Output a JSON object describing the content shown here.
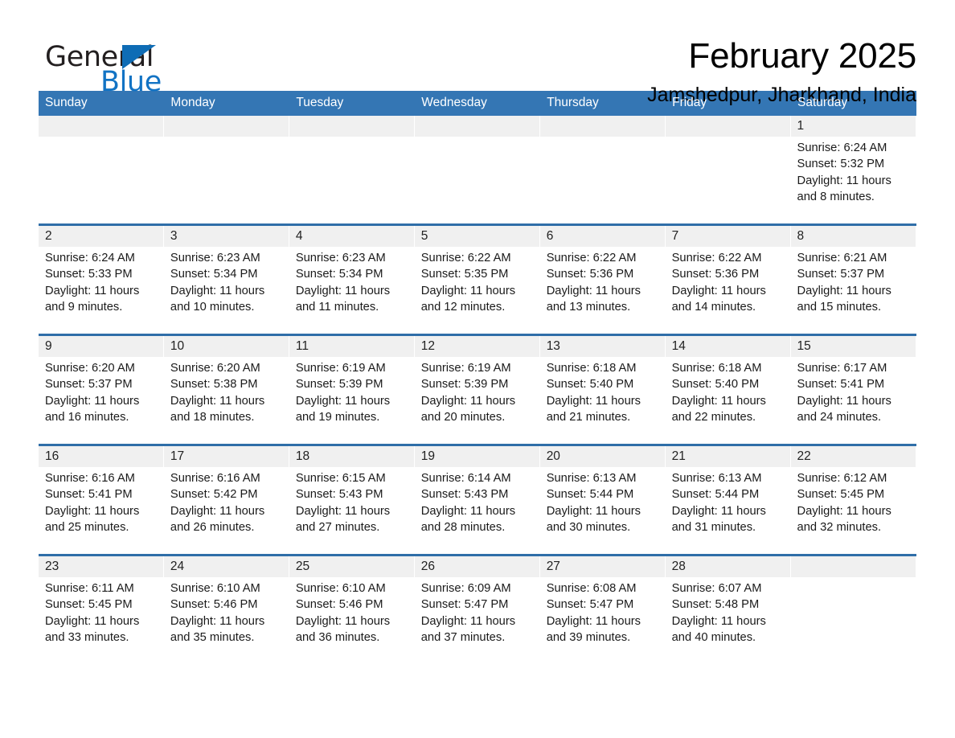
{
  "brand": {
    "name_part1": "General",
    "name_part2": "Blue",
    "accent_color": "#1273c4",
    "triangle_color": "#0e6cb5"
  },
  "header": {
    "month_title": "February 2025",
    "location": "Jamshedpur, Jharkhand, India"
  },
  "theme": {
    "header_row_bg": "#3476b4",
    "row_divider": "#2f6ea8",
    "daynum_band_bg": "#f0f0f0"
  },
  "weekdays": [
    "Sunday",
    "Monday",
    "Tuesday",
    "Wednesday",
    "Thursday",
    "Friday",
    "Saturday"
  ],
  "weeks": [
    [
      {
        "empty": true
      },
      {
        "empty": true
      },
      {
        "empty": true
      },
      {
        "empty": true
      },
      {
        "empty": true
      },
      {
        "empty": true
      },
      {
        "day": "1",
        "sunrise": "Sunrise: 6:24 AM",
        "sunset": "Sunset: 5:32 PM",
        "daylight1": "Daylight: 11 hours",
        "daylight2": "and 8 minutes."
      }
    ],
    [
      {
        "day": "2",
        "sunrise": "Sunrise: 6:24 AM",
        "sunset": "Sunset: 5:33 PM",
        "daylight1": "Daylight: 11 hours",
        "daylight2": "and 9 minutes."
      },
      {
        "day": "3",
        "sunrise": "Sunrise: 6:23 AM",
        "sunset": "Sunset: 5:34 PM",
        "daylight1": "Daylight: 11 hours",
        "daylight2": "and 10 minutes."
      },
      {
        "day": "4",
        "sunrise": "Sunrise: 6:23 AM",
        "sunset": "Sunset: 5:34 PM",
        "daylight1": "Daylight: 11 hours",
        "daylight2": "and 11 minutes."
      },
      {
        "day": "5",
        "sunrise": "Sunrise: 6:22 AM",
        "sunset": "Sunset: 5:35 PM",
        "daylight1": "Daylight: 11 hours",
        "daylight2": "and 12 minutes."
      },
      {
        "day": "6",
        "sunrise": "Sunrise: 6:22 AM",
        "sunset": "Sunset: 5:36 PM",
        "daylight1": "Daylight: 11 hours",
        "daylight2": "and 13 minutes."
      },
      {
        "day": "7",
        "sunrise": "Sunrise: 6:22 AM",
        "sunset": "Sunset: 5:36 PM",
        "daylight1": "Daylight: 11 hours",
        "daylight2": "and 14 minutes."
      },
      {
        "day": "8",
        "sunrise": "Sunrise: 6:21 AM",
        "sunset": "Sunset: 5:37 PM",
        "daylight1": "Daylight: 11 hours",
        "daylight2": "and 15 minutes."
      }
    ],
    [
      {
        "day": "9",
        "sunrise": "Sunrise: 6:20 AM",
        "sunset": "Sunset: 5:37 PM",
        "daylight1": "Daylight: 11 hours",
        "daylight2": "and 16 minutes."
      },
      {
        "day": "10",
        "sunrise": "Sunrise: 6:20 AM",
        "sunset": "Sunset: 5:38 PM",
        "daylight1": "Daylight: 11 hours",
        "daylight2": "and 18 minutes."
      },
      {
        "day": "11",
        "sunrise": "Sunrise: 6:19 AM",
        "sunset": "Sunset: 5:39 PM",
        "daylight1": "Daylight: 11 hours",
        "daylight2": "and 19 minutes."
      },
      {
        "day": "12",
        "sunrise": "Sunrise: 6:19 AM",
        "sunset": "Sunset: 5:39 PM",
        "daylight1": "Daylight: 11 hours",
        "daylight2": "and 20 minutes."
      },
      {
        "day": "13",
        "sunrise": "Sunrise: 6:18 AM",
        "sunset": "Sunset: 5:40 PM",
        "daylight1": "Daylight: 11 hours",
        "daylight2": "and 21 minutes."
      },
      {
        "day": "14",
        "sunrise": "Sunrise: 6:18 AM",
        "sunset": "Sunset: 5:40 PM",
        "daylight1": "Daylight: 11 hours",
        "daylight2": "and 22 minutes."
      },
      {
        "day": "15",
        "sunrise": "Sunrise: 6:17 AM",
        "sunset": "Sunset: 5:41 PM",
        "daylight1": "Daylight: 11 hours",
        "daylight2": "and 24 minutes."
      }
    ],
    [
      {
        "day": "16",
        "sunrise": "Sunrise: 6:16 AM",
        "sunset": "Sunset: 5:41 PM",
        "daylight1": "Daylight: 11 hours",
        "daylight2": "and 25 minutes."
      },
      {
        "day": "17",
        "sunrise": "Sunrise: 6:16 AM",
        "sunset": "Sunset: 5:42 PM",
        "daylight1": "Daylight: 11 hours",
        "daylight2": "and 26 minutes."
      },
      {
        "day": "18",
        "sunrise": "Sunrise: 6:15 AM",
        "sunset": "Sunset: 5:43 PM",
        "daylight1": "Daylight: 11 hours",
        "daylight2": "and 27 minutes."
      },
      {
        "day": "19",
        "sunrise": "Sunrise: 6:14 AM",
        "sunset": "Sunset: 5:43 PM",
        "daylight1": "Daylight: 11 hours",
        "daylight2": "and 28 minutes."
      },
      {
        "day": "20",
        "sunrise": "Sunrise: 6:13 AM",
        "sunset": "Sunset: 5:44 PM",
        "daylight1": "Daylight: 11 hours",
        "daylight2": "and 30 minutes."
      },
      {
        "day": "21",
        "sunrise": "Sunrise: 6:13 AM",
        "sunset": "Sunset: 5:44 PM",
        "daylight1": "Daylight: 11 hours",
        "daylight2": "and 31 minutes."
      },
      {
        "day": "22",
        "sunrise": "Sunrise: 6:12 AM",
        "sunset": "Sunset: 5:45 PM",
        "daylight1": "Daylight: 11 hours",
        "daylight2": "and 32 minutes."
      }
    ],
    [
      {
        "day": "23",
        "sunrise": "Sunrise: 6:11 AM",
        "sunset": "Sunset: 5:45 PM",
        "daylight1": "Daylight: 11 hours",
        "daylight2": "and 33 minutes."
      },
      {
        "day": "24",
        "sunrise": "Sunrise: 6:10 AM",
        "sunset": "Sunset: 5:46 PM",
        "daylight1": "Daylight: 11 hours",
        "daylight2": "and 35 minutes."
      },
      {
        "day": "25",
        "sunrise": "Sunrise: 6:10 AM",
        "sunset": "Sunset: 5:46 PM",
        "daylight1": "Daylight: 11 hours",
        "daylight2": "and 36 minutes."
      },
      {
        "day": "26",
        "sunrise": "Sunrise: 6:09 AM",
        "sunset": "Sunset: 5:47 PM",
        "daylight1": "Daylight: 11 hours",
        "daylight2": "and 37 minutes."
      },
      {
        "day": "27",
        "sunrise": "Sunrise: 6:08 AM",
        "sunset": "Sunset: 5:47 PM",
        "daylight1": "Daylight: 11 hours",
        "daylight2": "and 39 minutes."
      },
      {
        "day": "28",
        "sunrise": "Sunrise: 6:07 AM",
        "sunset": "Sunset: 5:48 PM",
        "daylight1": "Daylight: 11 hours",
        "daylight2": "and 40 minutes."
      },
      {
        "empty": true
      }
    ]
  ]
}
